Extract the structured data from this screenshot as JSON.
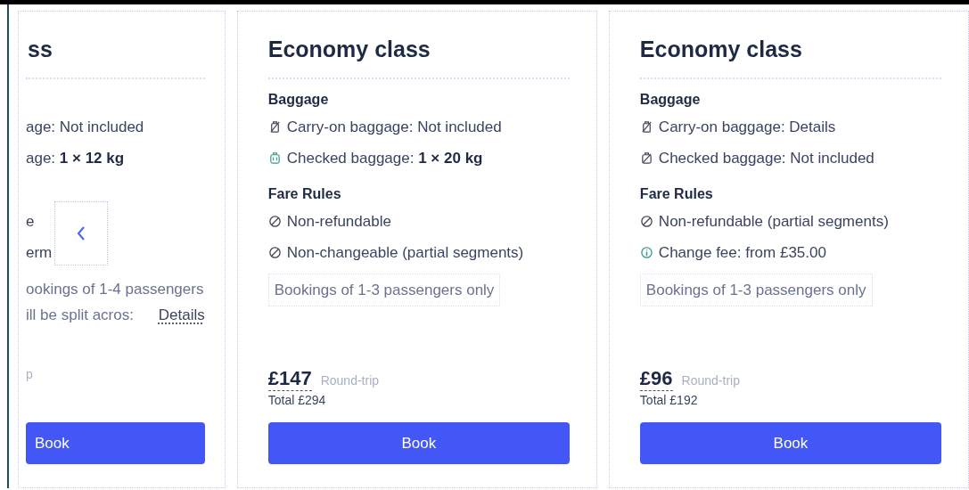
{
  "cards": [
    {
      "kind": "partial",
      "title": "ss",
      "baggage": {
        "items": [
          {
            "text": "age: Not included"
          },
          {
            "text": "age: **1 × 12 kg**"
          }
        ]
      },
      "fare_rules": {
        "items": [
          {
            "text": "e"
          },
          {
            "text": "erm"
          }
        ]
      },
      "notice": {
        "lines": [
          "ookings of 1-4 passengers",
          "ill be split acros:"
        ],
        "link": "Details"
      },
      "price_note": "p",
      "button": "Book"
    },
    {
      "kind": "full",
      "title": "Economy class",
      "baggage": {
        "heading": "Baggage",
        "items": [
          {
            "kind": "carry-on-none",
            "text": "Carry-on baggage: Not included"
          },
          {
            "kind": "checked-included",
            "text": "Checked baggage: **1 × 20 kg**"
          }
        ]
      },
      "fare_rules": {
        "heading": "Fare Rules",
        "items": [
          {
            "kind": "not-allowed",
            "text": "Non-refundable"
          },
          {
            "kind": "not-allowed",
            "text": "Non-changeable (partial segments)"
          }
        ]
      },
      "notice": {
        "lines": [
          "Bookings of 1-3 passengers only"
        ]
      },
      "price": "£147",
      "price_note": "Round-trip",
      "total": "Total £294",
      "button": "Book"
    },
    {
      "kind": "full",
      "title": "Economy class",
      "baggage": {
        "heading": "Baggage",
        "items": [
          {
            "kind": "carry-on-none",
            "text": "Carry-on baggage: Details"
          },
          {
            "kind": "checked-none",
            "text": "Checked baggage: Not included"
          }
        ]
      },
      "fare_rules": {
        "heading": "Fare Rules",
        "items": [
          {
            "kind": "not-allowed",
            "text": "Non-refundable (partial segments)"
          },
          {
            "kind": "info",
            "text": "Change fee: from £35.00"
          }
        ]
      },
      "notice": {
        "lines": [
          "Bookings of 1-3 passengers only"
        ]
      },
      "price": "£96",
      "price_note": "Round-trip",
      "total": "Total £192",
      "button": "Book"
    }
  ]
}
